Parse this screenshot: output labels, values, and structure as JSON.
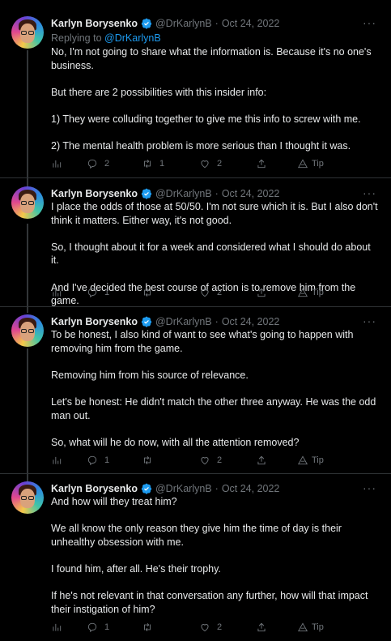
{
  "tweets": [
    {
      "name": "Karlyn Borysenko",
      "handle": "@DrKarlynB",
      "dot": "·",
      "date": "Oct 24, 2022",
      "more": "···",
      "replying_prefix": "Replying to",
      "replying_handle": "@DrKarlynB",
      "paragraphs": [
        "No, I'm not going to share what the information is. Because it's no one's business.",
        "But there are 2 possibilities with this insider info:",
        "1) They were colluding together to give me this info to screw with me.",
        "2) The mental health problem is more serious than I thought it was."
      ],
      "replies": "2",
      "retweets": "1",
      "likes": "2",
      "tip": "Tip"
    },
    {
      "name": "Karlyn Borysenko",
      "handle": "@DrKarlynB",
      "dot": "·",
      "date": "Oct 24, 2022",
      "more": "···",
      "paragraphs": [
        "I place the odds of those at 50/50. I'm not sure which it is. But I also don't think it matters. Either way, it's not good.",
        "So, I thought about it for a week and considered what I should do about it.",
        "And I've decided the best course of action is to remove him from the game."
      ],
      "replies": "1",
      "retweets": "",
      "likes": "2",
      "tip": "Tip"
    },
    {
      "name": "Karlyn Borysenko",
      "handle": "@DrKarlynB",
      "dot": "·",
      "date": "Oct 24, 2022",
      "more": "···",
      "paragraphs": [
        "To be honest, I also kind of want to see what's going to happen with removing him from the game.",
        "Removing him from his source of relevance.",
        "Let's be honest: He didn't match the other three anyway. He was the odd man out.",
        "So, what will he do now, with all the attention removed?"
      ],
      "replies": "1",
      "retweets": "",
      "likes": "2",
      "tip": "Tip"
    },
    {
      "name": "Karlyn Borysenko",
      "handle": "@DrKarlynB",
      "dot": "·",
      "date": "Oct 24, 2022",
      "more": "···",
      "paragraphs": [
        "And how will they treat him?",
        "We all know the only reason they give him the time of day is their unhealthy obsession with me.",
        "I found him, after all. He's their trophy.",
        "If he's not relevant in that conversation any further, how will that impact their instigation of him?"
      ],
      "replies": "1",
      "retweets": "",
      "likes": "2",
      "tip": "Tip"
    }
  ],
  "colors": {
    "background": "#000000",
    "text": "#e7e9ea",
    "muted": "#71767b",
    "link": "#1d9bf0",
    "verified": "#1d9bf0"
  },
  "icons": [
    "analytics-icon",
    "reply-icon",
    "retweet-icon",
    "like-icon",
    "share-icon",
    "tip-icon",
    "verified-badge-icon",
    "more-icon"
  ]
}
